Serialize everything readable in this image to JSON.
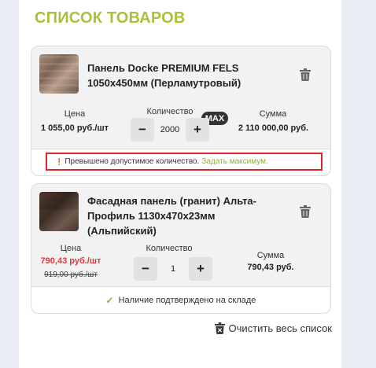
{
  "title": "СПИСОК ТОВАРОВ",
  "labels": {
    "price": "Цена",
    "quantity": "Количество",
    "sum": "Сумма"
  },
  "items": [
    {
      "name": "Панель Docke PREMIUM FELS 1050x450мм (Перламутровый)",
      "price": "1 055,00 руб./шт",
      "quantity": "2000",
      "max_badge": "MAX",
      "sum": "2 110 000,00 руб.",
      "warning_text": "Превышено допустимое количество.",
      "warning_link": "Задать максимум."
    },
    {
      "name": "Фасадная панель (гранит) Альта-Профиль 1130x470x23мм (Альпийский)",
      "price": "790,43 руб./шт",
      "old_price": "919,00 руб./шт",
      "quantity": "1",
      "sum": "790,43 руб.",
      "status_text": "Наличие подтверждено на складе"
    }
  ],
  "stepper": {
    "minus": "−",
    "plus": "+"
  },
  "clear_all": "Очистить весь список",
  "colors": {
    "accent": "#a8c23a",
    "price_red": "#e2363f",
    "warning_border": "#e0242b",
    "link_green": "#8eb12d"
  }
}
